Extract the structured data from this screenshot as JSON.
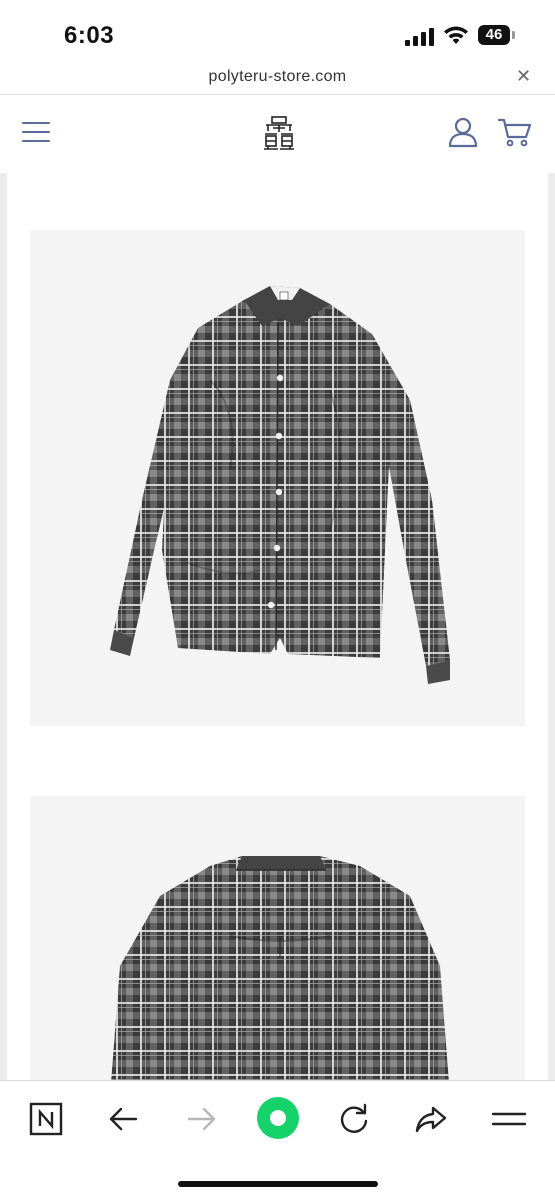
{
  "status_bar": {
    "time": "6:03",
    "battery_level": "46",
    "icons": [
      "signal-icon",
      "wifi-icon",
      "battery-icon"
    ]
  },
  "browser": {
    "url": "polyteru-store.com",
    "close_icon": "close-icon"
  },
  "site_header": {
    "icons": [
      "menu-icon",
      "logo-icon",
      "user-icon",
      "cart-icon"
    ],
    "accent_color": "#5a6a9a"
  },
  "products": {
    "images": [
      {
        "view": "front",
        "pattern": "plaid check shirt",
        "colors": [
          "#3a3a3a",
          "#e8e8e8",
          "#6a6a6a"
        ]
      },
      {
        "view": "back",
        "pattern": "plaid check shirt",
        "colors": [
          "#3a3a3a",
          "#e8e8e8",
          "#6a6a6a"
        ]
      }
    ],
    "card_background": "#f4f4f4"
  },
  "toolbar": {
    "buttons": [
      "naver-icon",
      "back-arrow-icon",
      "forward-arrow-icon",
      "home-green-icon",
      "refresh-icon",
      "share-icon",
      "menu-lines-icon"
    ],
    "forward_enabled": false,
    "green_color": "#15d26a"
  }
}
